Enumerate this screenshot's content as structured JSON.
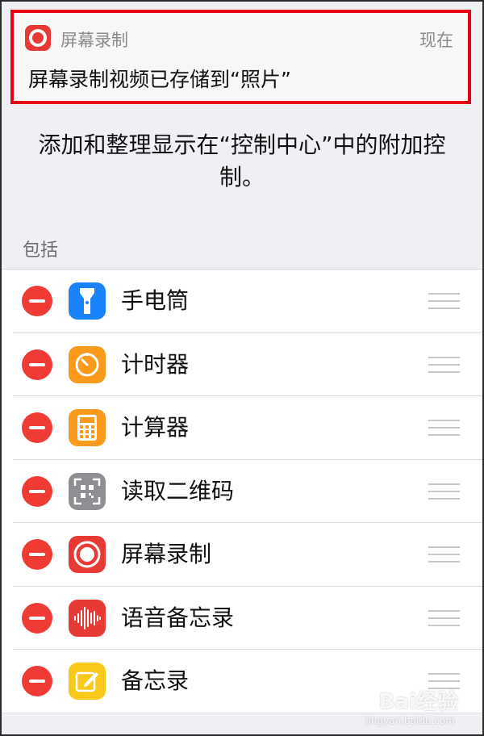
{
  "notification": {
    "app_name": "屏幕录制",
    "time": "现在",
    "message": "屏幕录制视频已存储到“照片”"
  },
  "description": "添加和整理显示在“控制中心”中的附加控制。",
  "section_header": "包括",
  "controls": [
    {
      "label": "手电筒",
      "icon": "flashlight-icon",
      "color": "#1a82fb"
    },
    {
      "label": "计时器",
      "icon": "timer-icon",
      "color": "#f99a1c"
    },
    {
      "label": "计算器",
      "icon": "calculator-icon",
      "color": "#f99a1c"
    },
    {
      "label": "读取二维码",
      "icon": "qr-code-icon",
      "color": "#8e8e93"
    },
    {
      "label": "屏幕录制",
      "icon": "screen-record-icon",
      "color": "#e83a35"
    },
    {
      "label": "语音备忘录",
      "icon": "voice-memo-icon",
      "color": "#e83a35"
    },
    {
      "label": "备忘录",
      "icon": "notes-icon",
      "color": "#f9c91c"
    }
  ],
  "watermark": {
    "text": "Bai经验",
    "sub": "jingyan.baidu.com"
  }
}
